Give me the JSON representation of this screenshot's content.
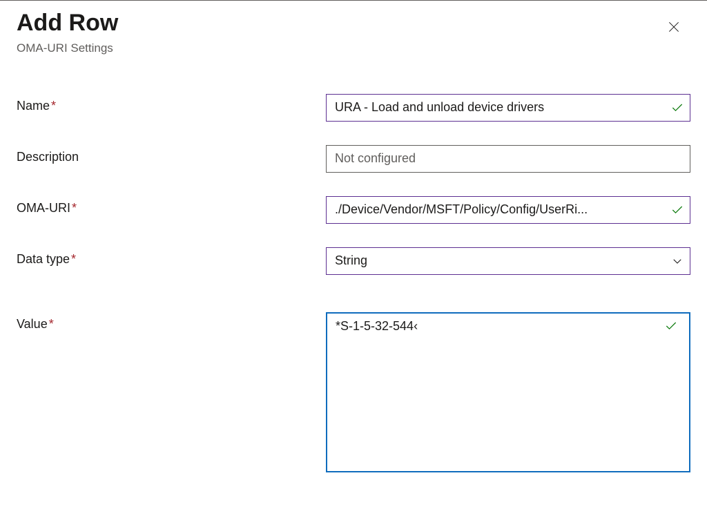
{
  "header": {
    "title": "Add Row",
    "subtitle": "OMA-URI Settings"
  },
  "form": {
    "name": {
      "label": "Name",
      "value": "URA - Load and unload device drivers"
    },
    "description": {
      "label": "Description",
      "placeholder": "Not configured",
      "value": ""
    },
    "oma_uri": {
      "label": "OMA-URI",
      "value": "./Device/Vendor/MSFT/Policy/Config/UserRi..."
    },
    "data_type": {
      "label": "Data type",
      "value": "String"
    },
    "value": {
      "label": "Value",
      "value": "*S-1-5-32-544‹"
    }
  },
  "required_marker": "*"
}
